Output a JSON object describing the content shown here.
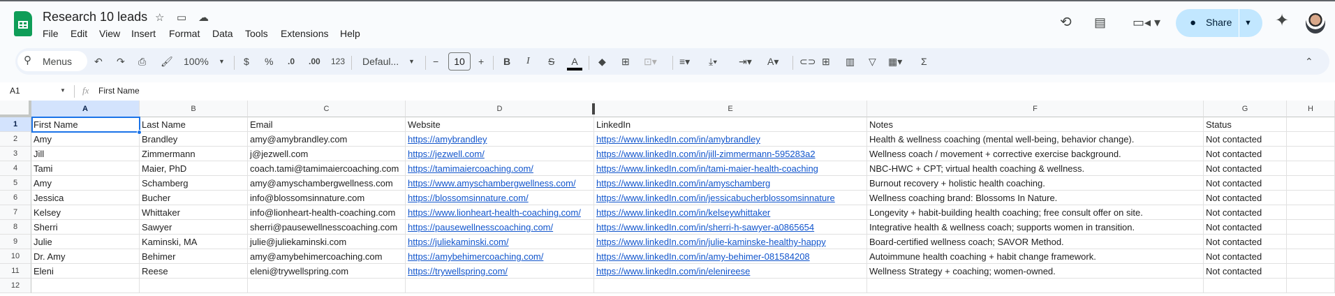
{
  "app": {
    "title": "Research 10 leads",
    "menus": [
      "File",
      "Edit",
      "View",
      "Insert",
      "Format",
      "Data",
      "Tools",
      "Extensions",
      "Help"
    ],
    "share_label": "Share"
  },
  "toolbar": {
    "search_label": "Menus",
    "zoom": "100%",
    "currency": "$",
    "percent": "%",
    "dec_decrease": ".0",
    "dec_increase": ".00",
    "number_format": "123",
    "font": "Defaul...",
    "font_size": "10"
  },
  "formula_bar": {
    "cell_ref": "A1",
    "fx": "fx",
    "value": "First Name"
  },
  "columns": [
    "A",
    "B",
    "C",
    "D",
    "E",
    "F",
    "G",
    "H"
  ],
  "rows": [
    [
      "First Name",
      "Last Name",
      "Email",
      "Website",
      "LinkedIn",
      "Notes",
      "Status"
    ],
    [
      "Amy",
      "Brandley",
      "amy@amybrandley.com",
      "https://amybrandley",
      "https://www.linkedIn.com/in/amybrandley",
      "Health & wellness coaching (mental well-being, behavior change).",
      "Not contacted"
    ],
    [
      "Jill",
      "Zimmermann",
      "j@jezwell.com",
      "https://jezwell.com/",
      "https://www.linkedIn.com/in/jill-zimmermann-595283a2",
      "Wellness coach / movement + corrective exercise background.",
      "Not contacted"
    ],
    [
      "Tami",
      "Maier, PhD",
      "coach.tami@tamimaiercoaching.com",
      "https://tamimaiercoaching.com/",
      "https://www.linkedIn.com/in/tami-maier-health-coaching",
      "NBC-HWC + CPT; virtual health coaching & wellness.",
      "Not contacted"
    ],
    [
      "Amy",
      "Schamberg",
      "amy@amyschambergwellness.com",
      "https://www.amyschambergwellness.com/",
      "https://www.linkedIn.com/in/amyschamberg",
      "Burnout recovery + holistic health coaching.",
      "Not contacted"
    ],
    [
      "Jessica",
      "Bucher",
      "info@blossomsinnature.com",
      "https://blossomsinnature.com/",
      "https://www.linkedIn.com/in/jessicabucherblossomsinnature",
      "Wellness coaching brand: Blossoms In Nature.",
      "Not contacted"
    ],
    [
      "Kelsey",
      "Whittaker",
      "info@lionheart-health-coaching.com",
      "https://www.lionheart-health-coaching.com/",
      "https://www.linkedIn.com/in/kelseywhittaker",
      "Longevity + habit-building health coaching; free consult offer on site.",
      "Not contacted"
    ],
    [
      "Sherri",
      "Sawyer",
      "sherri@pausewellnesscoaching.com",
      "https://pausewellnesscoaching.com/",
      "https://www.linkedIn.com/in/sherri-h-sawyer-a0865654",
      "Integrative health & wellness coach; supports women in transition.",
      "Not contacted"
    ],
    [
      "Julie",
      "Kaminski, MA",
      "julie@juliekaminski.com",
      "https://juliekaminski.com/",
      "https://www.linkedIn.com/in/julie-kaminske-healthy-happy",
      "Board-certified wellness coach; SAVOR Method.",
      "Not contacted"
    ],
    [
      "Dr. Amy",
      "Behimer",
      "amy@amybehimercoaching.com",
      "https://amybehimercoaching.com/",
      "https://www.linkedIn.com/in/amy-behimer-081584208",
      "Autoimmune health coaching + habit change framework.",
      "Not contacted"
    ],
    [
      "Eleni",
      "Reese",
      "eleni@trywellspring.com",
      "https://trywellspring.com/",
      "https://www.linkedIn.com/in/elenireese",
      "Wellness Strategy + coaching; women-owned.",
      "Not contacted"
    ],
    [
      "",
      "",
      "",
      "",
      "",
      "",
      ""
    ]
  ],
  "row_numbers": [
    "1",
    "2",
    "3",
    "4",
    "5",
    "6",
    "7",
    "8",
    "9",
    "10",
    "11",
    "12"
  ],
  "colors": {
    "accent": "#1a73e8",
    "share_bg": "#c2e7ff",
    "link": "#1155cc",
    "sheets_green": "#0f9d58"
  }
}
